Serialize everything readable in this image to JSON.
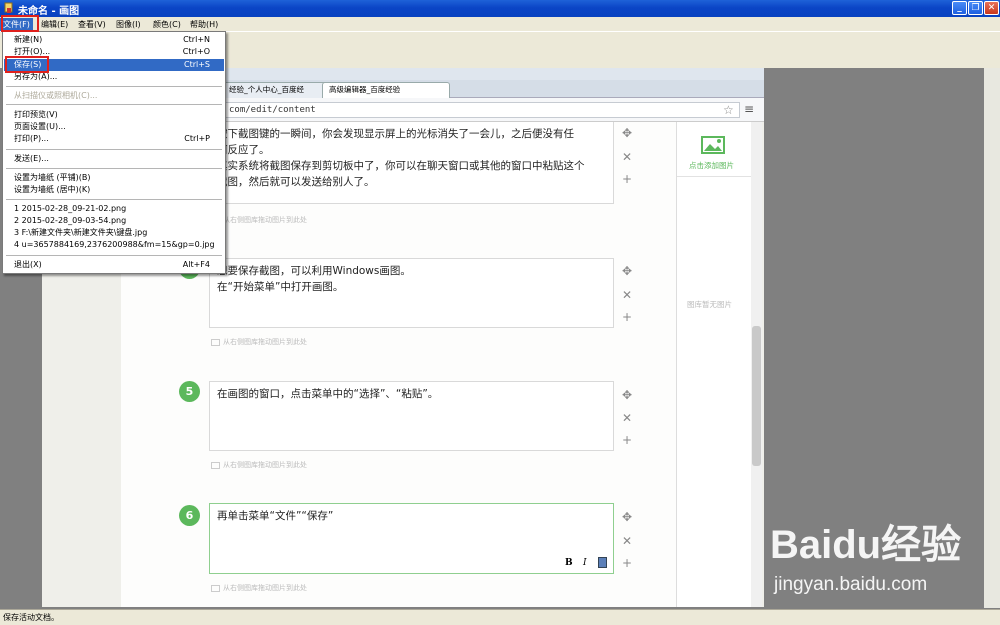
{
  "window": {
    "title": "未命名 - 画图",
    "minimize": "_",
    "restore": "❐",
    "close": "✕"
  },
  "menubar": {
    "items": [
      "文件(F)",
      "编辑(E)",
      "查看(V)",
      "图像(I)",
      "颜色(C)",
      "帮助(H)"
    ]
  },
  "file_menu": {
    "items": [
      {
        "label": "新建(N)",
        "shortcut": "Ctrl+N"
      },
      {
        "label": "打开(O)...",
        "shortcut": "Ctrl+O"
      },
      {
        "label": "保存(S)",
        "shortcut": "Ctrl+S"
      },
      {
        "label": "另存为(A)..."
      },
      {
        "label": "从扫描仪或照相机(C)..."
      },
      {
        "label": "打印预览(V)"
      },
      {
        "label": "页面设置(U)..."
      },
      {
        "label": "打印(P)...",
        "shortcut": "Ctrl+P"
      },
      {
        "label": "发送(E)..."
      },
      {
        "label": "设置为墙纸 (平铺)(B)"
      },
      {
        "label": "设置为墙纸 (居中)(K)"
      },
      {
        "label": "1 2015-02-28_09-21-02.png"
      },
      {
        "label": "2 2015-02-28_09-03-54.png"
      },
      {
        "label": "3 F:\\新建文件夹\\新建文件夹\\键盘.jpg"
      },
      {
        "label": "4 u=3657884169,2376200988&fm=15&gp=0.jpg"
      },
      {
        "label": "退出(X)",
        "shortcut": "Alt+F4"
      }
    ]
  },
  "browser": {
    "tabs": [
      "经验_个人中心_百度经",
      "高级编辑器_百度经验"
    ],
    "url": "com/edit/content"
  },
  "steps": [
    {
      "number": "",
      "lines": [
        "按下截图键的一瞬间，你会发现显示屏上的光标消失了一会儿，之后便没有任",
        "何反应了。",
        "其实系统将截图保存到剪切板中了，你可以在聊天窗口或其他的窗口中粘贴这个",
        "截图，然后就可以发送给别人了。"
      ]
    },
    {
      "number": "4",
      "lines": [
        "想要保存截图，可以利用Windows画图。",
        "在“开始菜单”中打开画图。"
      ]
    },
    {
      "number": "5",
      "lines": [
        "在画图的窗口，点击菜单中的“选择”、“粘贴”。"
      ]
    },
    {
      "number": "6",
      "lines": [
        "再单击菜单“文件”“保存”"
      ]
    }
  ],
  "step_hint": "从右侧图库拖动图片到此处",
  "sidebar": {
    "add_image": "点击添加图片",
    "empty": "图库暂无图片"
  },
  "editor_buttons": {
    "bold": "B",
    "italic": "I"
  },
  "status": "保存活动文档。",
  "watermark": {
    "logo": "Baidu经验",
    "url": "jingyan.baidu.com"
  },
  "colors": {
    "accent_red": "#e0201c",
    "step_green": "#5cb85c",
    "menu_select": "#316ac5"
  }
}
